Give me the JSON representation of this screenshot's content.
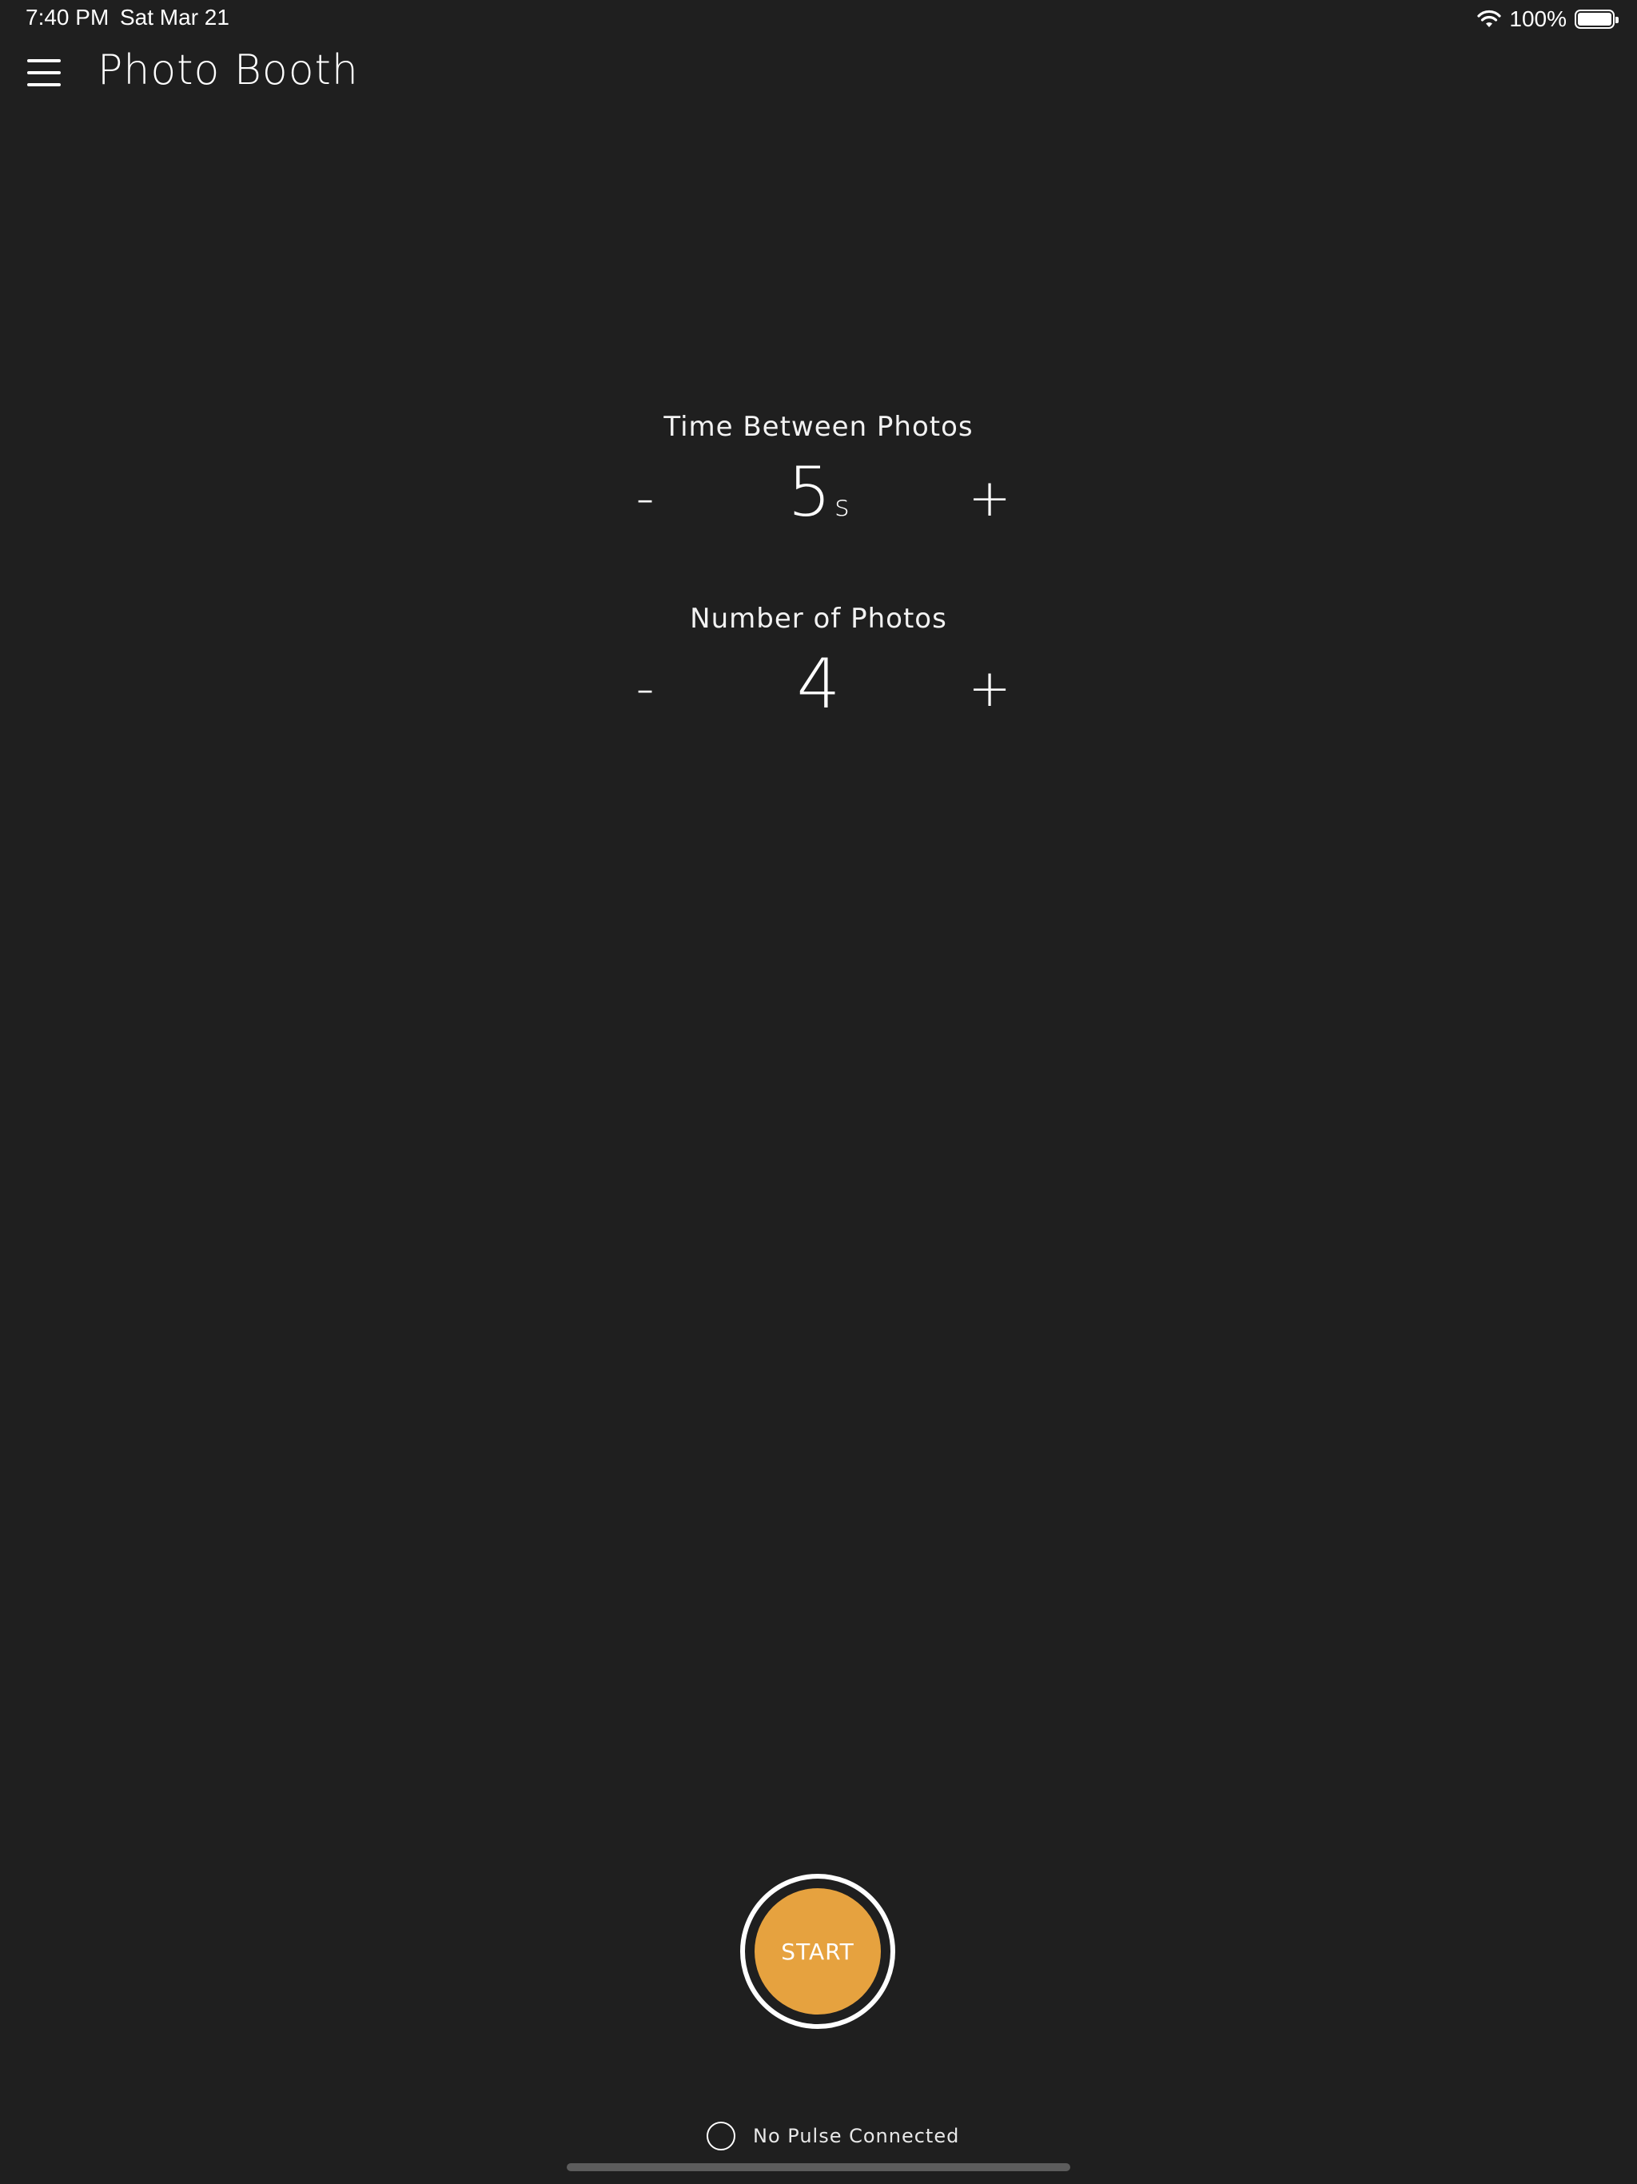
{
  "status_bar": {
    "time": "7:40 PM",
    "date": "Sat Mar 21",
    "battery_percent": "100%",
    "icons": [
      "wifi-icon",
      "battery-icon"
    ]
  },
  "header": {
    "menu_icon": "hamburger-menu-icon",
    "title": "Photo Booth"
  },
  "settings": {
    "time_between": {
      "label": "Time Between Photos",
      "decrement_label": "-",
      "increment_label": "+",
      "value": "5",
      "unit": "s"
    },
    "number_of_photos": {
      "label": "Number of Photos",
      "decrement_label": "-",
      "increment_label": "+",
      "value": "4"
    }
  },
  "start_button": {
    "label": "START",
    "color": "#e6a23f"
  },
  "pulse": {
    "status_text": "No Pulse Connected"
  },
  "colors": {
    "background": "#1f1f1f",
    "accent": "#e6a23f",
    "text": "#ffffff"
  }
}
